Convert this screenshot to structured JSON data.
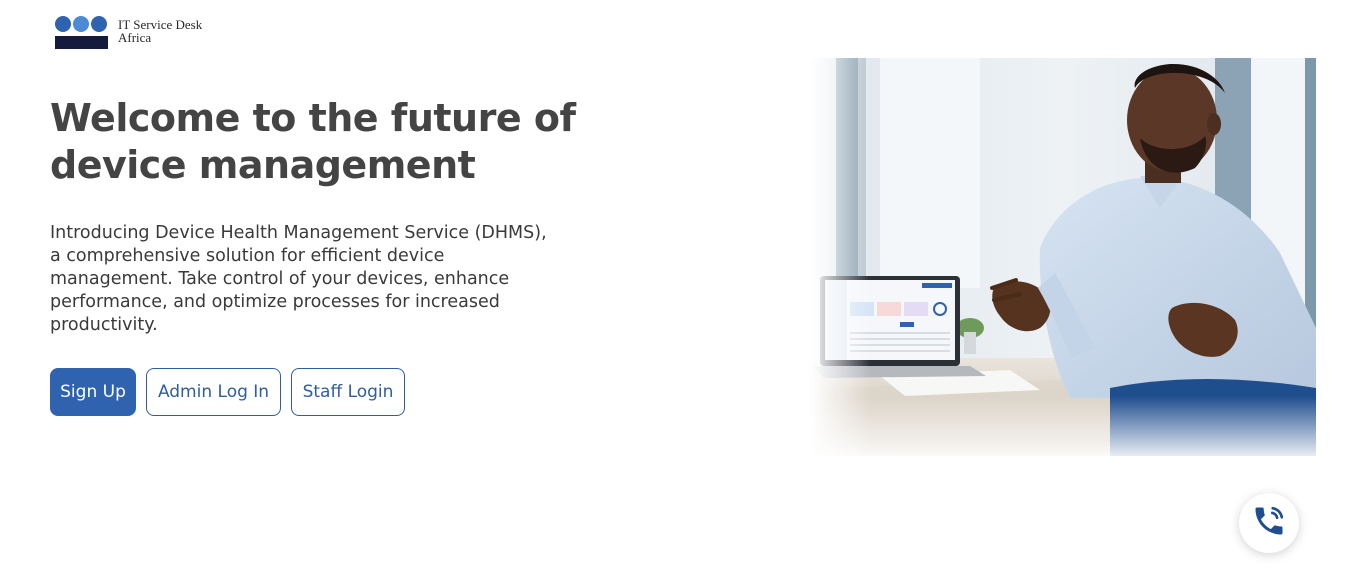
{
  "brand": {
    "name_line1": "IT Service Desk",
    "name_line2": "Africa",
    "colors": {
      "primary": "#2f63b0",
      "dark": "#141b3c",
      "heading": "#444444"
    }
  },
  "hero": {
    "title": "Welcome to the future of device management",
    "description": "Introducing Device Health Management Service (DHMS), a comprehensive solution for efficient device management. Take control of your devices, enhance performance, and optimize processes for increased productivity."
  },
  "actions": {
    "signup_label": "Sign Up",
    "admin_login_label": "Admin Log In",
    "staff_login_label": "Staff Login"
  },
  "image": {
    "subject": "man-presenting-laptop-dashboard"
  },
  "floating": {
    "icon": "phone-call-icon"
  }
}
